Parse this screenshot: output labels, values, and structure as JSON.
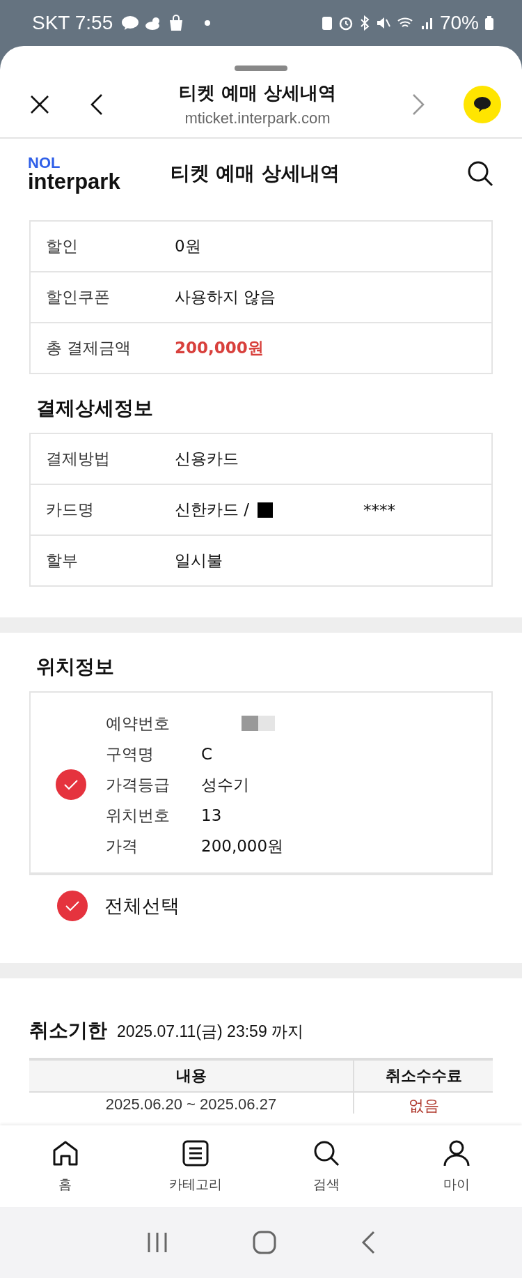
{
  "status_bar": {
    "carrier": "SKT",
    "time": "7:55",
    "battery": "70%"
  },
  "browser": {
    "title": "티켓 예매 상세내역",
    "url": "mticket.interpark.com"
  },
  "app_header": {
    "logo_top": "NOL",
    "logo_bottom": "interpark",
    "title": "티켓 예매 상세내역"
  },
  "payment_summary": [
    {
      "label": "할인",
      "value": "0원",
      "kind": "plain"
    },
    {
      "label": "할인쿠폰",
      "value": "사용하지 않음",
      "kind": "plain"
    },
    {
      "label": "총 결제금액",
      "value": "200,000원",
      "kind": "total"
    }
  ],
  "payment_detail": {
    "title": "결제상세정보",
    "rows": [
      {
        "label": "결제방법",
        "value": "신용카드"
      },
      {
        "label": "카드명",
        "value": "신한카드 /",
        "masked_tail": "****"
      },
      {
        "label": "할부",
        "value": "일시불"
      }
    ]
  },
  "seat_info": {
    "title": "위치정보",
    "checked": true,
    "rows": [
      {
        "label": "예약번호"
      },
      {
        "label": "구역명",
        "value": "C"
      },
      {
        "label": "가격등급",
        "value": "성수기"
      },
      {
        "label": "위치번호",
        "value": "13"
      },
      {
        "label": "가격",
        "value": "200,000원"
      }
    ]
  },
  "select_all": {
    "label": "전체선택",
    "checked": true
  },
  "cancel": {
    "title": "취소기한",
    "deadline": "2025.07.11(금) 23:59 까지",
    "columns": [
      "내용",
      "취소수수료"
    ],
    "rows": [
      {
        "period": "2025.06.20 ~ 2025.06.27",
        "fee": "없음"
      }
    ]
  },
  "bottom_nav": [
    {
      "label": "홈"
    },
    {
      "label": "카테고리"
    },
    {
      "label": "검색"
    },
    {
      "label": "마이"
    }
  ]
}
